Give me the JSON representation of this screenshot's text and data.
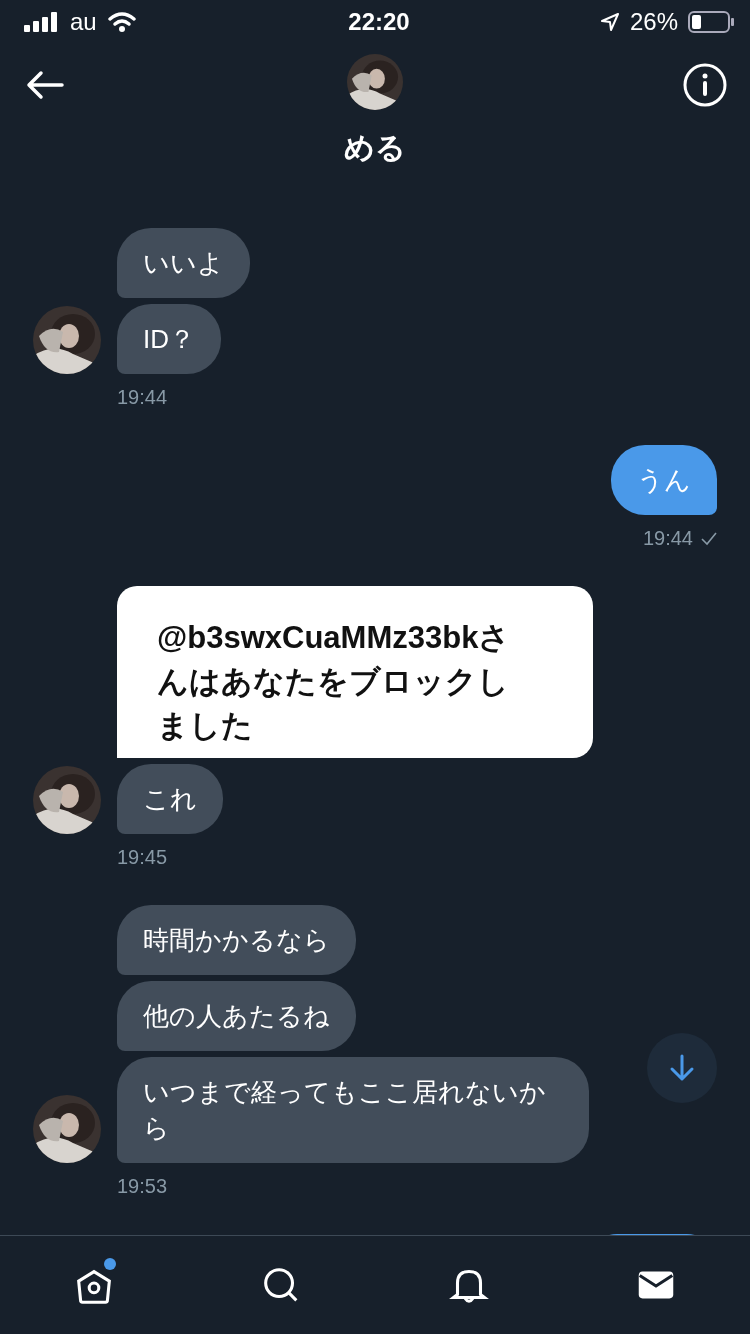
{
  "status_bar": {
    "carrier": "au",
    "time": "22:20",
    "battery": "26%"
  },
  "header": {
    "name": "める"
  },
  "groups": [
    {
      "kind": "received",
      "bubbles": [
        {
          "kind": "text",
          "text": "いいよ"
        },
        {
          "kind": "text",
          "text": "ID？"
        }
      ],
      "time": "19:44",
      "read": false
    },
    {
      "kind": "sent",
      "bubbles": [
        {
          "kind": "text",
          "text": "うん"
        }
      ],
      "time": "19:44",
      "read": true
    },
    {
      "kind": "received",
      "bubbles": [
        {
          "text": "@b3swxCuaMMz33bkさんはあなたをブロックしました"
        },
        {
          "kind": "text",
          "text": "これ"
        }
      ],
      "time": "19:45",
      "read": false
    },
    {
      "kind": "received",
      "bubbles": [
        {
          "kind": "text",
          "text": "時間かかるなら"
        },
        {
          "kind": "text",
          "text": "他の人あたるね"
        },
        {
          "kind": "text",
          "text": "いつまで経ってもここ居れないから"
        }
      ],
      "time": "19:53",
      "read": false
    },
    {
      "kind": "sent",
      "bubbles": [
        {
          "kind": "cut_off"
        }
      ]
    }
  ],
  "tabs": [
    {
      "kind": "home",
      "selected": false,
      "badge": true
    },
    {
      "kind": "search",
      "selected": false,
      "badge": false
    },
    {
      "kind": "notifications",
      "selected": false,
      "badge": false
    },
    {
      "kind": "messages",
      "selected": true,
      "badge": false
    }
  ]
}
